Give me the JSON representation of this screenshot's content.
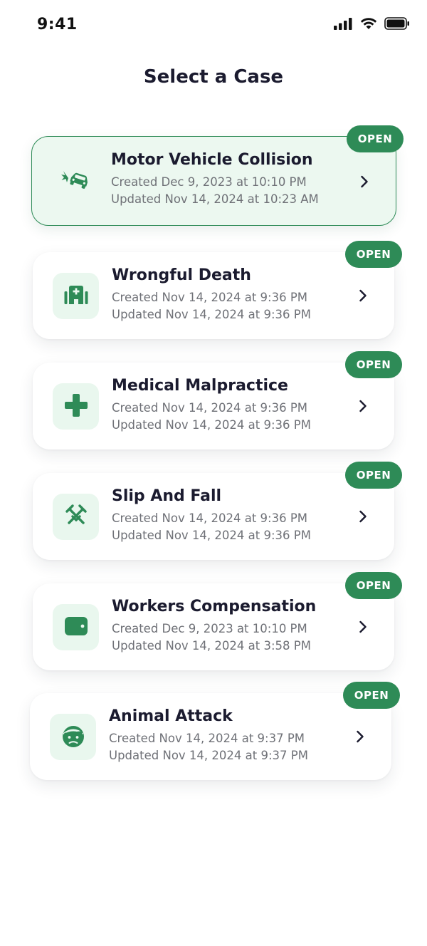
{
  "status_bar": {
    "time": "9:41"
  },
  "page": {
    "title": "Select a Case"
  },
  "accent_color": "#2e8b57",
  "cases": [
    {
      "title": "Motor Vehicle Collision",
      "created": "Created Dec 9, 2023 at 10:10 PM",
      "updated": "Updated Nov 14, 2024 at 10:23 AM",
      "status": "OPEN",
      "icon": "car-crash-icon",
      "selected": true
    },
    {
      "title": "Wrongful Death",
      "created": "Created Nov 14, 2024 at 9:36 PM",
      "updated": "Updated Nov 14, 2024 at 9:36 PM",
      "status": "OPEN",
      "icon": "hospital-icon",
      "selected": false
    },
    {
      "title": "Medical Malpractice",
      "created": "Created Nov 14, 2024 at 9:36 PM",
      "updated": "Updated Nov 14, 2024 at 9:36 PM",
      "status": "OPEN",
      "icon": "medical-cross-icon",
      "selected": false
    },
    {
      "title": "Slip And Fall",
      "created": "Created Nov 14, 2024 at 9:36 PM",
      "updated": "Updated Nov 14, 2024 at 9:36 PM",
      "status": "OPEN",
      "icon": "crutches-icon",
      "selected": false
    },
    {
      "title": "Workers Compensation",
      "created": "Created Dec 9, 2023 at 10:10 PM",
      "updated": "Updated Nov 14, 2024 at 3:58 PM",
      "status": "OPEN",
      "icon": "wallet-icon",
      "selected": false
    },
    {
      "title": "Animal Attack",
      "created": "Created Nov 14, 2024 at 9:37 PM",
      "updated": "Updated Nov 14, 2024 at 9:37 PM",
      "status": "OPEN",
      "icon": "injured-face-icon",
      "selected": false
    }
  ]
}
